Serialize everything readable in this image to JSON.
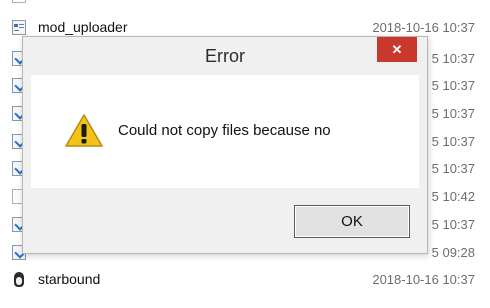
{
  "files": [
    {
      "icon": "blank-file-icon",
      "name": "",
      "date": ""
    },
    {
      "icon": "executable-file-icon",
      "name": "mod_uploader",
      "date": "2018-10-16 10:37"
    },
    {
      "icon": "shortcut-file-icon",
      "name": "",
      "date": "5 10:37"
    },
    {
      "icon": "shortcut-file-icon",
      "name": "",
      "date": "5 10:37"
    },
    {
      "icon": "shortcut-file-icon",
      "name": "",
      "date": "5 10:37"
    },
    {
      "icon": "shortcut-file-icon",
      "name": "",
      "date": "5 10:37"
    },
    {
      "icon": "shortcut-file-icon",
      "name": "",
      "date": "5 10:37"
    },
    {
      "icon": "blank-file-icon",
      "name": "",
      "date": "5 10:42"
    },
    {
      "icon": "shortcut-file-icon",
      "name": "",
      "date": "5 10:37"
    },
    {
      "icon": "shortcut-file-icon",
      "name": "",
      "date": "5 09:28"
    },
    {
      "icon": "penguin-icon",
      "name": "starbound",
      "date": "2018-10-16 10:37"
    }
  ],
  "dialog": {
    "title": "Error",
    "close_glyph": "✕",
    "message": "Could not copy files because no",
    "ok_label": "OK",
    "icon": "warning-icon"
  },
  "colors": {
    "close_button": "#c8382c",
    "warning_fill": "#f2c318",
    "dialog_bg": "#f0f0f0"
  }
}
